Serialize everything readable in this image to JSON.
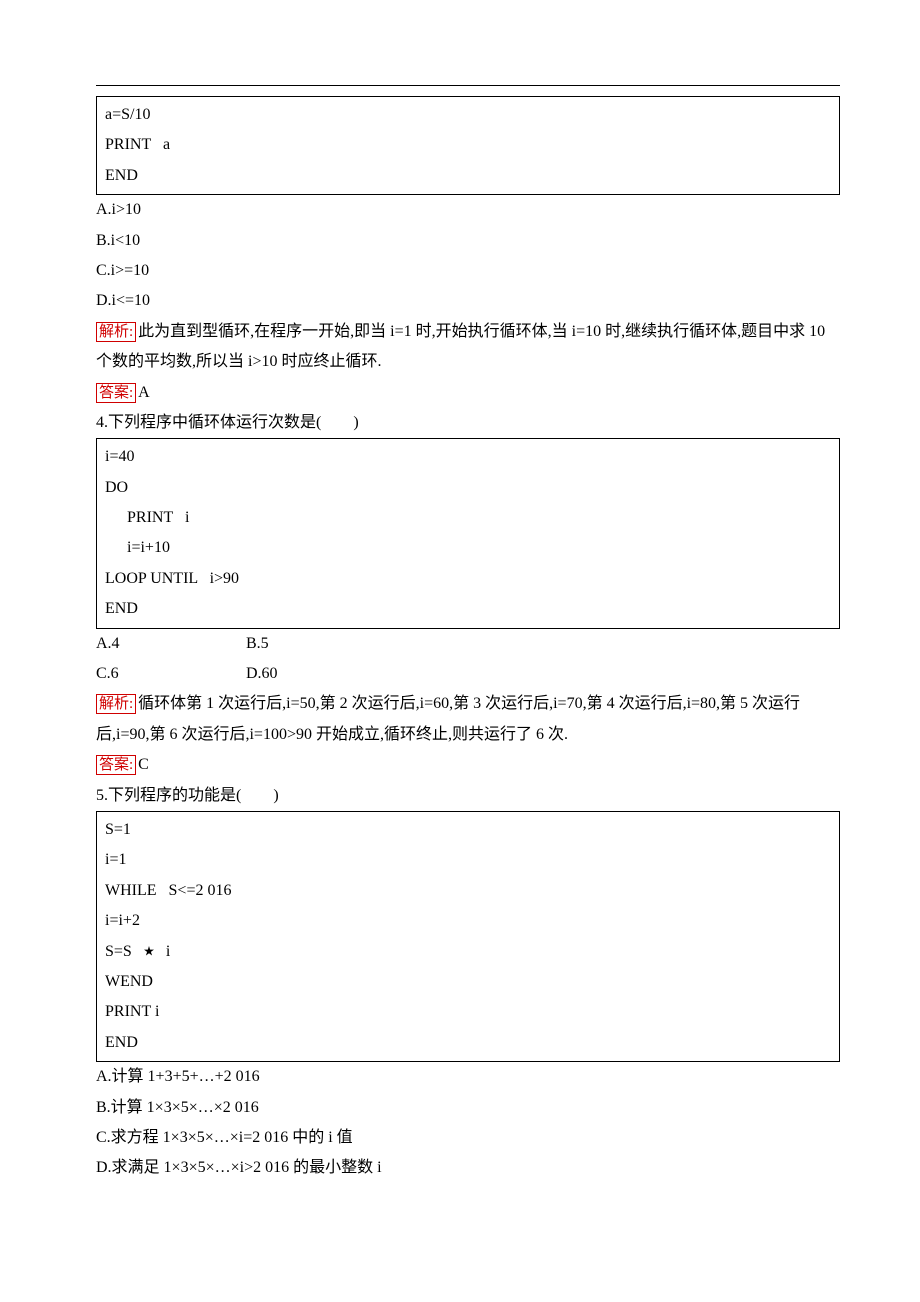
{
  "codeA": {
    "l1": "a=S/10",
    "l2": "PRINT   a",
    "l3": "END"
  },
  "optsA": {
    "a": "A.i>10",
    "b": "B.i<10",
    "c": "C.i>=10",
    "d": "D.i<=10"
  },
  "analysisA": {
    "tag": "解析:",
    "text": "此为直到型循环,在程序一开始,即当 i=1 时,开始执行循环体,当 i=10 时,继续执行循环体,题目中求 10 个数的平均数,所以当 i>10 时应终止循环."
  },
  "answerA": {
    "tag": "答案:",
    "text": "A"
  },
  "q4": {
    "stem": "4.下列程序中循环体运行次数是(　　)",
    "code": {
      "l1": "i=40",
      "l2": "DO",
      "l3": "PRINT   i",
      "l4": "i=i+10",
      "l5": "LOOP UNTIL   i>90",
      "l6": "END"
    },
    "opts": {
      "a": "A.4",
      "b": "B.5",
      "c": "C.6",
      "d": "D.60"
    },
    "analysis": {
      "tag": "解析:",
      "text": "循环体第 1 次运行后,i=50,第 2 次运行后,i=60,第 3 次运行后,i=70,第 4 次运行后,i=80,第 5 次运行后,i=90,第 6 次运行后,i=100>90 开始成立,循环终止,则共运行了 6 次."
    },
    "answer": {
      "tag": "答案:",
      "text": "C"
    }
  },
  "q5": {
    "stem": "5.下列程序的功能是(　　)",
    "code": {
      "l1": "S=1",
      "l2": "i=1",
      "l3": "WHILE   S<=2 016",
      "l4": "i=i+2",
      "l5": "",
      "l6pre": "S=S",
      "l6post": "i",
      "l7": "WEND",
      "l8": "PRINT i",
      "l9": "END"
    },
    "opts": {
      "a": "A.计算 1+3+5+…+2 016",
      "b": "B.计算 1×3×5×…×2 016",
      "c": "C.求方程 1×3×5×…×i=2 016 中的 i 值",
      "d": "D.求满足 1×3×5×…×i>2 016 的最小整数 i"
    }
  }
}
